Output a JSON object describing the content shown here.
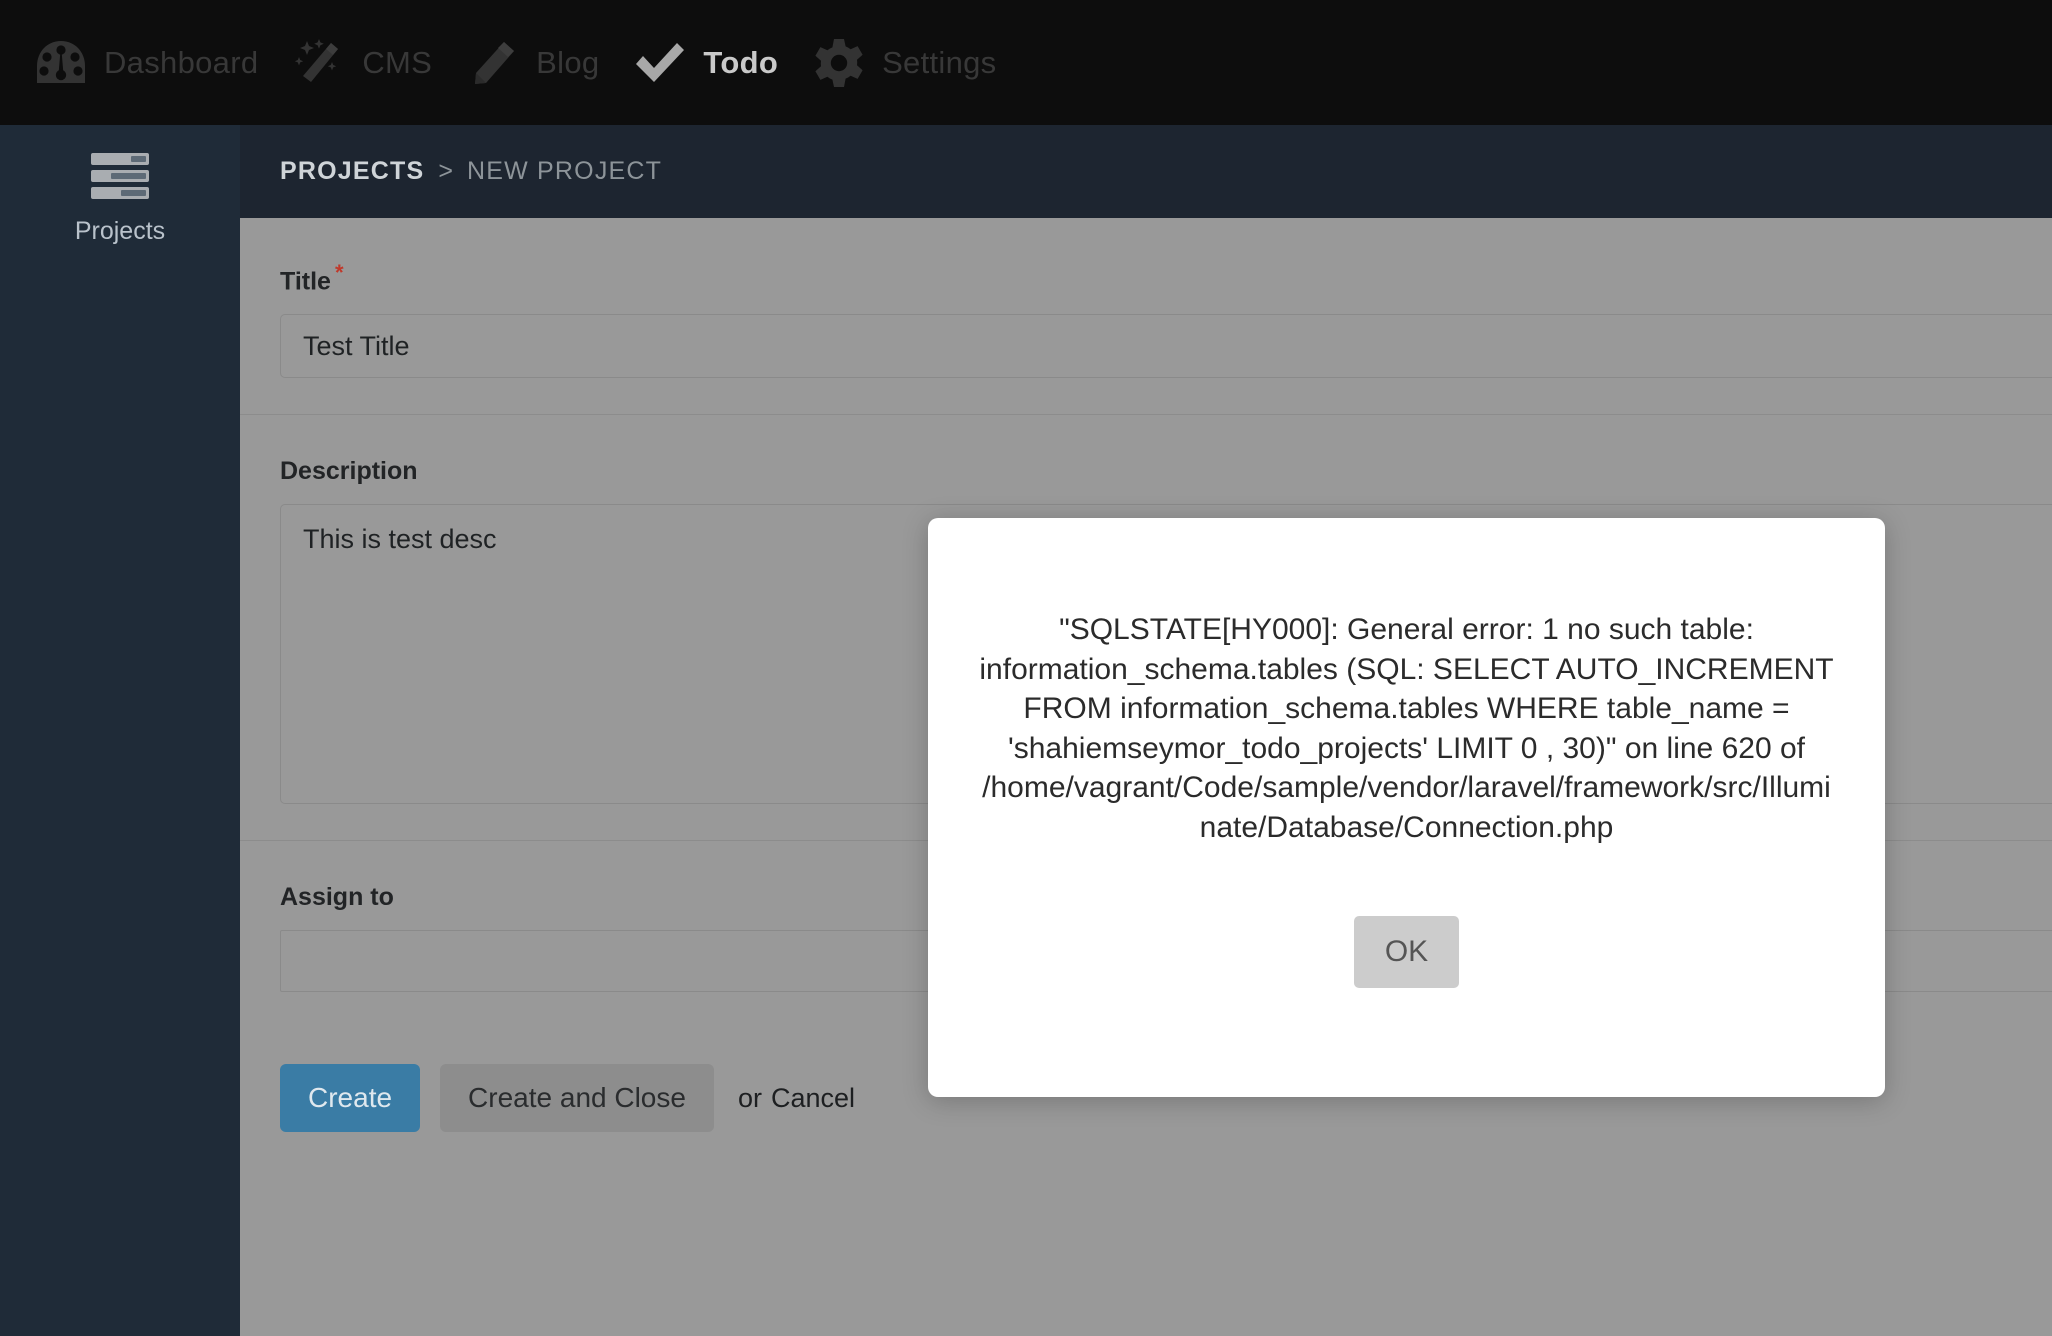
{
  "topnav": {
    "items": [
      {
        "label": "Dashboard",
        "icon": "gauge-icon",
        "active": false
      },
      {
        "label": "CMS",
        "icon": "magic-wand-icon",
        "active": false
      },
      {
        "label": "Blog",
        "icon": "pencil-icon",
        "active": false
      },
      {
        "label": "Todo",
        "icon": "check-icon",
        "active": true
      },
      {
        "label": "Settings",
        "icon": "gear-icon",
        "active": false
      }
    ]
  },
  "sidebar": {
    "items": [
      {
        "label": "Projects",
        "icon": "tasks-list-icon"
      }
    ]
  },
  "breadcrumb": {
    "parent": "PROJECTS",
    "separator": ">",
    "current": "NEW PROJECT"
  },
  "form": {
    "title": {
      "label": "Title",
      "required_mark": "*",
      "value": "Test Title",
      "placeholder": ""
    },
    "description": {
      "label": "Description",
      "value": "This is test desc",
      "placeholder": ""
    },
    "assign_to": {
      "label": "Assign to",
      "value": "",
      "placeholder": ""
    }
  },
  "actions": {
    "create_label": "Create",
    "create_and_close_label": "Create and Close",
    "or_text": "or",
    "cancel_label": "Cancel"
  },
  "modal": {
    "message": "\"SQLSTATE[HY000]: General error: 1 no such table: information_schema.tables (SQL: SELECT AUTO_INCREMENT FROM information_schema.tables WHERE table_name = 'shahiemseymor_todo_projects' LIMIT 0 , 30)\" on line 620 of /home/vagrant/Code/sample/vendor/laravel/framework/src/Illuminate/Database/Connection.php",
    "ok_label": "OK"
  },
  "colors": {
    "topnav_bg": "#0d0d0d",
    "sidebar_bg": "#1f2b38",
    "breadcrumb_bg": "#1d2530",
    "content_bg": "#999999",
    "primary_button": "#3a7ca5",
    "secondary_button": "#8d8d8d",
    "required_star": "#c0392b",
    "modal_bg": "#ffffff",
    "modal_button": "#cccccc"
  }
}
